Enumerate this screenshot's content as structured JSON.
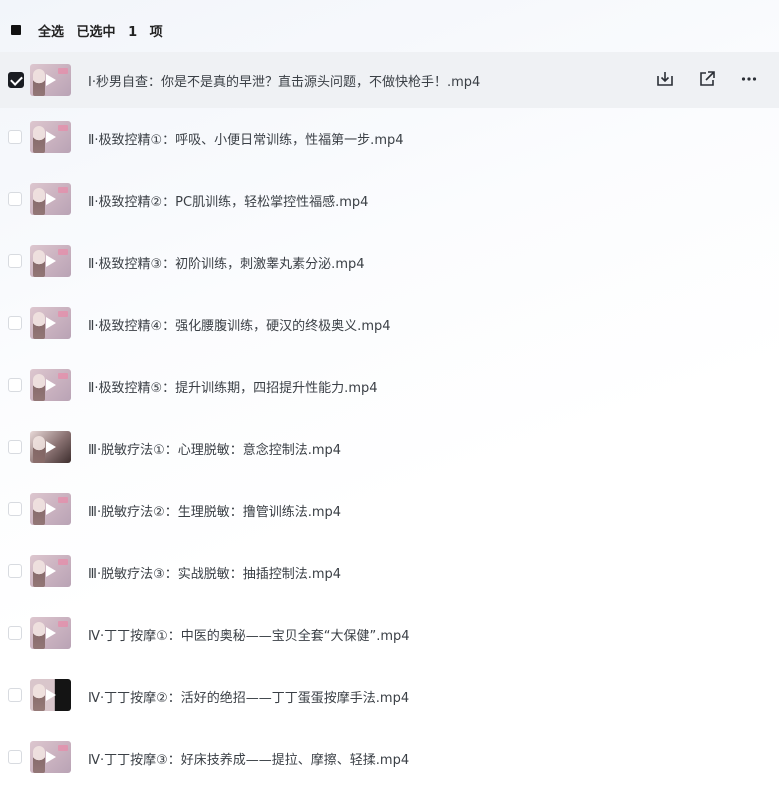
{
  "header": {
    "select_all": "全选",
    "selected_text": "已选中",
    "selected_count": "1",
    "unit": "项"
  },
  "files": [
    {
      "name": "Ⅰ·秒男自查：你是不是真的早泄？直击源头问题，不做快枪手！.mp4",
      "selected": true
    },
    {
      "name": "Ⅱ·极致控精①：呼吸、小便日常训练，性福第一步.mp4",
      "selected": false
    },
    {
      "name": "Ⅱ·极致控精②：PC肌训练，轻松掌控性福感.mp4",
      "selected": false
    },
    {
      "name": "Ⅱ·极致控精③：初阶训练，刺激睾丸素分泌.mp4",
      "selected": false
    },
    {
      "name": "Ⅱ·极致控精④：强化腰腹训练，硬汉的终极奥义.mp4",
      "selected": false
    },
    {
      "name": "Ⅱ·极致控精⑤：提升训练期，四招提升性能力.mp4",
      "selected": false
    },
    {
      "name": "Ⅲ·脱敏疗法①：心理脱敏：意念控制法.mp4",
      "selected": false
    },
    {
      "name": "Ⅲ·脱敏疗法②：生理脱敏：撸管训练法.mp4",
      "selected": false
    },
    {
      "name": "Ⅲ·脱敏疗法③：实战脱敏：抽插控制法.mp4",
      "selected": false
    },
    {
      "name": "Ⅳ·丁丁按摩①：中医的奥秘——宝贝全套“大保健”.mp4",
      "selected": false
    },
    {
      "name": "Ⅳ·丁丁按摩②：活好的绝招——丁丁蛋蛋按摩手法.mp4",
      "selected": false
    },
    {
      "name": "Ⅳ·丁丁按摩③：好床技养成——提拉、摩擦、轻揉.mp4",
      "selected": false
    }
  ],
  "icons": {
    "play": "play-icon",
    "download": "download-icon",
    "share": "share-icon",
    "more": "more-icon"
  },
  "colors": {
    "selected_row_bg": "#eff1f4",
    "checkbox_checked": "#1a1d22",
    "text": "#3a3f45"
  }
}
